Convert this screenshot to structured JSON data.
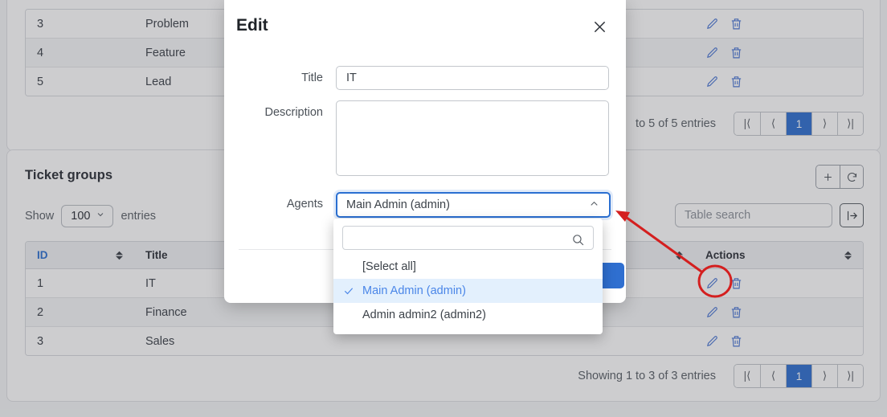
{
  "top_table": {
    "rows": [
      {
        "id": "3",
        "title": "Problem"
      },
      {
        "id": "4",
        "title": "Feature"
      },
      {
        "id": "5",
        "title": "Lead"
      }
    ],
    "footer_text": "to 5 of 5 entries",
    "pagination": {
      "first": "|⟨",
      "prev": "⟨",
      "current": "1",
      "next": "⟩",
      "last": "⟩|"
    }
  },
  "ticket_groups": {
    "title": "Ticket groups",
    "add_label": "+",
    "refresh_label": "⟳",
    "show_label": "Show",
    "entries_label": "entries",
    "page_size": "100",
    "search_placeholder": "Table search",
    "search_value": "",
    "export_label": "export-icon",
    "columns": [
      "ID",
      "Title",
      "Actions"
    ],
    "rows": [
      {
        "id": "1",
        "title": "IT"
      },
      {
        "id": "2",
        "title": "Finance"
      },
      {
        "id": "3",
        "title": "Sales"
      }
    ],
    "row_actions": {
      "edit": "edit-icon",
      "delete": "delete-icon"
    },
    "footer_text": "Showing 1 to 3 of 3 entries",
    "pagination": {
      "first": "|⟨",
      "prev": "⟨",
      "current": "1",
      "next": "⟩",
      "last": "⟩|"
    }
  },
  "modal": {
    "title": "Edit",
    "close_label": "✕",
    "fields": {
      "title_label": "Title",
      "title_value": "IT",
      "description_label": "Description",
      "description_value": "",
      "agents_label": "Agents",
      "agents_value": "Main Admin (admin)"
    },
    "dropdown": {
      "search_value": "",
      "search_placeholder": "",
      "options": [
        {
          "label": "[Select all]",
          "selected": false
        },
        {
          "label": "Main Admin (admin)",
          "selected": true
        },
        {
          "label": "Admin admin2 (admin2)",
          "selected": false
        }
      ]
    }
  },
  "colors": {
    "accent": "#2f6fd0",
    "link": "#4a86e8",
    "annotation": "#d41f1f",
    "selected_row_bg": "#e3f0fd"
  }
}
